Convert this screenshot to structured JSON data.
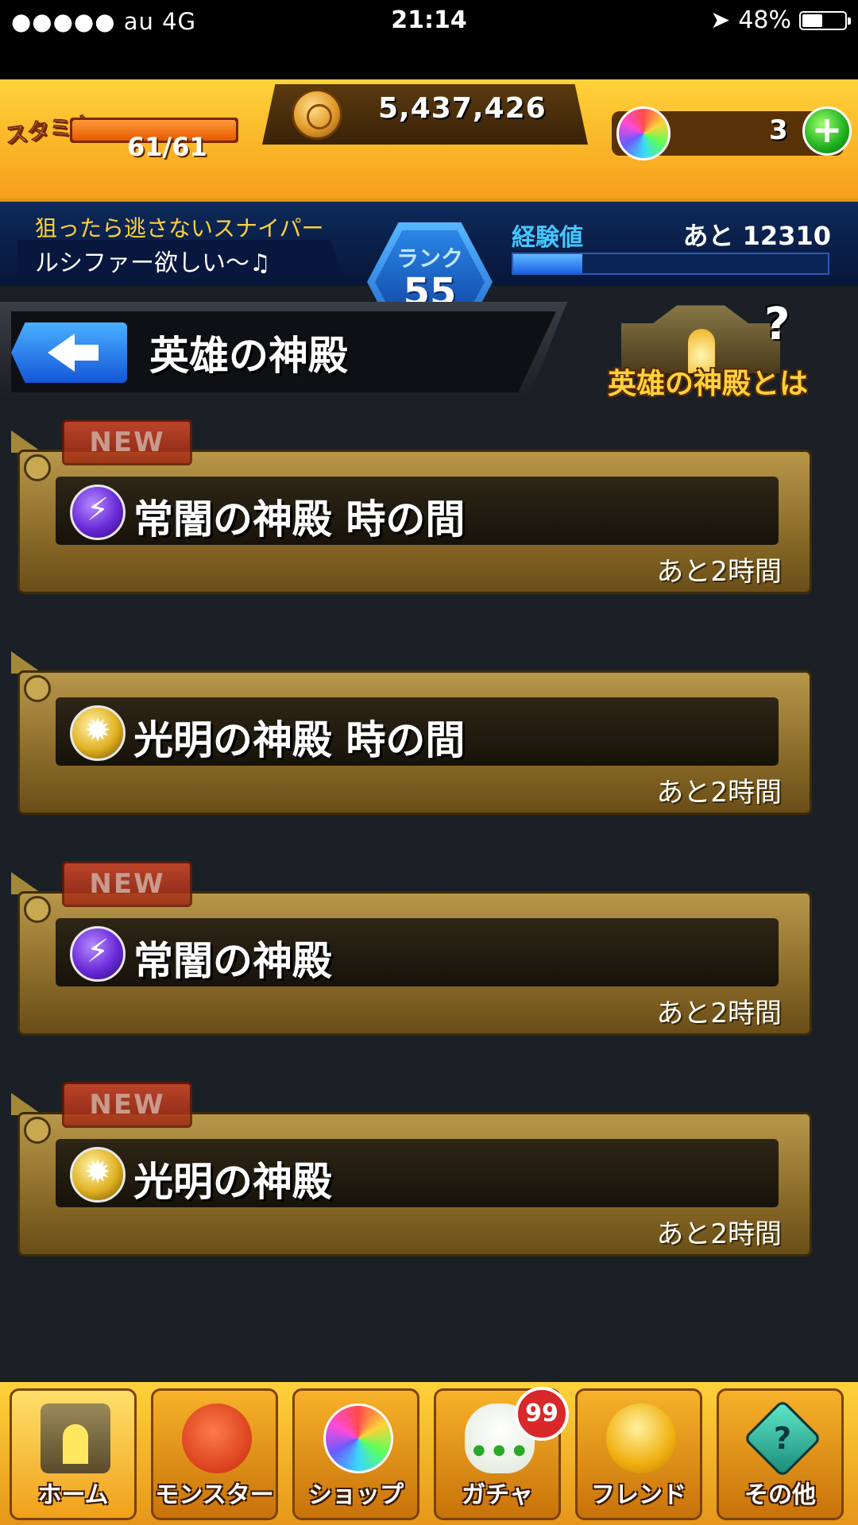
{
  "status_bar": {
    "carrier": "●●●●● au   4G",
    "time": "21:14",
    "battery_percent": "48%",
    "battery_level": 0.48,
    "icons": [
      "location-arrow-icon",
      "battery-icon"
    ]
  },
  "header": {
    "stamina_label": "スタミナ",
    "stamina_value": "61/61",
    "stamina_fraction": 1.0,
    "gold": "5,437,426",
    "orb_count": "3",
    "plus_label": "+",
    "rank_label": "ランク",
    "rank_value": "55",
    "player_title": "狙ったら逃さないスナイパー",
    "player_comment": "ルシファー欲しい～♫",
    "exp_label": "経験値",
    "exp_remaining": "あと 12310",
    "exp_fraction": 0.22
  },
  "page": {
    "title": "英雄の神殿",
    "back_icon": "back-arrow-icon",
    "about_label": "英雄の神殿とは",
    "about_mark": "?"
  },
  "dungeons": [
    {
      "name": "常闇の神殿 時の間",
      "remaining": "あと2時間",
      "element": "dark",
      "is_new": true,
      "badge": "NEW"
    },
    {
      "name": "光明の神殿 時の間",
      "remaining": "あと2時間",
      "element": "light",
      "is_new": false,
      "badge": ""
    },
    {
      "name": "常闇の神殿",
      "remaining": "あと2時間",
      "element": "dark",
      "is_new": true,
      "badge": "NEW"
    },
    {
      "name": "光明の神殿",
      "remaining": "あと2時間",
      "element": "light",
      "is_new": true,
      "badge": "NEW"
    }
  ],
  "nav": {
    "items": [
      {
        "label": "ホーム",
        "icon": "home-icon",
        "active": true
      },
      {
        "label": "モンスター",
        "icon": "monster-icon",
        "active": false
      },
      {
        "label": "ショップ",
        "icon": "orb-icon",
        "active": false
      },
      {
        "label": "ガチャ",
        "icon": "egg-icon",
        "active": false
      },
      {
        "label": "フレンド",
        "icon": "friends-icon",
        "active": false
      },
      {
        "label": "その他",
        "icon": "other-icon",
        "active": false
      }
    ],
    "gacha_badge": "99"
  },
  "colors": {
    "header_gold": "#f7a21c",
    "header_blue": "#08163a",
    "exp_blue": "#44c6ff",
    "panel_gold": "#b8974a",
    "new_badge": "#d74a2a"
  }
}
